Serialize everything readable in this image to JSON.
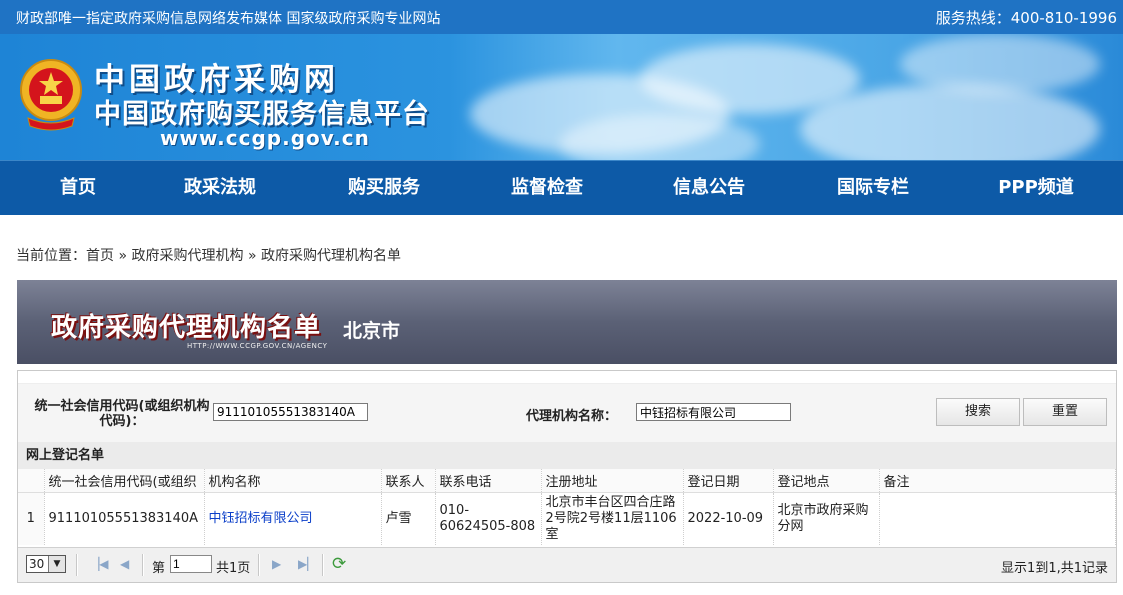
{
  "topbar": {
    "slogan": "财政部唯一指定政府采购信息网络发布媒体 国家级政府采购专业网站",
    "hotline": "服务热线：400-810-1996"
  },
  "banner": {
    "title_line1": "中国政府采购网",
    "title_line2": "中国政府购买服务信息平台",
    "url": "www.ccgp.gov.cn"
  },
  "nav": [
    "首页",
    "政采法规",
    "购买服务",
    "监督检查",
    "信息公告",
    "国际专栏",
    "PPP频道"
  ],
  "breadcrumb": {
    "prefix": "当前位置：",
    "items": [
      "首页",
      "政府采购代理机构",
      "政府采购代理机构名单"
    ],
    "separator": "»"
  },
  "title_banner": {
    "title": "政府采购代理机构名单",
    "city": "北京市",
    "url": "HTTP://WWW.CCGP.GOV.CN/AGENCY"
  },
  "search": {
    "credit_code_label_line1": "统一社会信用代码(或组织机构",
    "credit_code_label_line2": "代码)：",
    "credit_code_value": "91110105551383140A",
    "agency_name_label": "代理机构名称：",
    "agency_name_value": "中钰招标有限公司",
    "search_button": "搜索",
    "reset_button": "重置"
  },
  "list": {
    "section_title": "网上登记名单",
    "columns": [
      "",
      "统一社会信用代码(或组织",
      "机构名称",
      "联系人",
      "联系电话",
      "注册地址",
      "登记日期",
      "登记地点",
      "备注"
    ],
    "rows": [
      {
        "index": "1",
        "credit_code": "91110105551383140A",
        "name": "中钰招标有限公司",
        "contact": "卢雪",
        "phone": "010-60624505-808",
        "address": "北京市丰台区四合庄路2号院2号楼11层1106室",
        "date": "2022-10-09",
        "place": "北京市政府采购分网",
        "note": ""
      }
    ]
  },
  "pager": {
    "page_size": "30",
    "page_prefix": "第",
    "page_value": "1",
    "page_total": "共1页",
    "summary": "显示1到1,共1记录"
  }
}
